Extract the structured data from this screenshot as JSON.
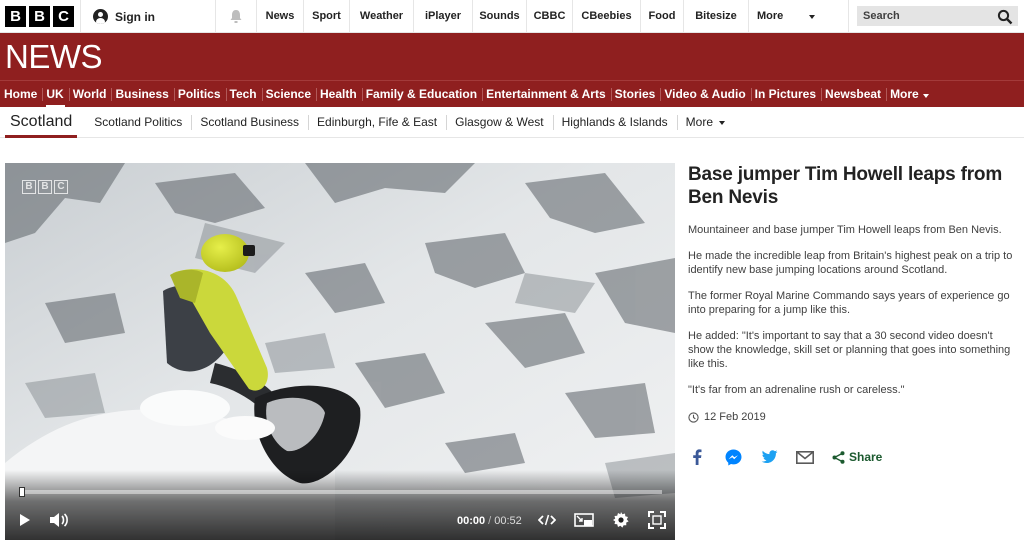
{
  "masthead": {
    "logo_letters": [
      "B",
      "B",
      "C"
    ],
    "signin_label": "Sign in",
    "nav": [
      {
        "label": "News",
        "name": "nav-news"
      },
      {
        "label": "Sport",
        "name": "nav-sport"
      },
      {
        "label": "Weather",
        "name": "nav-weather"
      },
      {
        "label": "iPlayer",
        "name": "nav-iplayer"
      },
      {
        "label": "Sounds",
        "name": "nav-sounds"
      },
      {
        "label": "CBBC",
        "name": "nav-cbbc"
      },
      {
        "label": "CBeebies",
        "name": "nav-cbeebies"
      },
      {
        "label": "Food",
        "name": "nav-food"
      },
      {
        "label": "Bitesize",
        "name": "nav-bitesize"
      },
      {
        "label": "More",
        "name": "nav-more"
      }
    ],
    "search_placeholder": "Search"
  },
  "banner": {
    "title": "NEWS",
    "color": "#8f1f1f"
  },
  "sections": [
    {
      "label": "Home",
      "active": false
    },
    {
      "label": "UK",
      "active": true
    },
    {
      "label": "World",
      "active": false
    },
    {
      "label": "Business",
      "active": false
    },
    {
      "label": "Politics",
      "active": false
    },
    {
      "label": "Tech",
      "active": false
    },
    {
      "label": "Science",
      "active": false
    },
    {
      "label": "Health",
      "active": false
    },
    {
      "label": "Family & Education",
      "active": false
    },
    {
      "label": "Entertainment & Arts",
      "active": false
    },
    {
      "label": "Stories",
      "active": false
    },
    {
      "label": "Video & Audio",
      "active": false
    },
    {
      "label": "In Pictures",
      "active": false
    },
    {
      "label": "Newsbeat",
      "active": false
    },
    {
      "label": "More",
      "active": false
    }
  ],
  "subnav": {
    "title": "Scotland",
    "items": [
      "Scotland Politics",
      "Scotland Business",
      "Edinburgh, Fife & East",
      "Glasgow & West",
      "Highlands & Islands"
    ],
    "more_label": "More"
  },
  "player": {
    "watermark": [
      "B",
      "B",
      "C"
    ],
    "current_time": "00:00",
    "separator": "/",
    "duration": "00:52",
    "progress_fraction": 0.0
  },
  "article": {
    "headline": "Base jumper Tim Howell leaps from Ben Nevis",
    "paragraphs": [
      "Mountaineer and base jumper Tim Howell leaps from Ben Nevis.",
      "He made the incredible leap from Britain's highest peak on a trip to identify new base jumping locations around Scotland.",
      "The former Royal Marine Commando says years of experience go into preparing for a jump like this.",
      "He added: \"It's important to say that a 30 second video doesn't show the knowledge, skill set or planning that goes into something like this.",
      "\"It's far from an adrenaline rush or careless.\""
    ],
    "date": "12 Feb 2019"
  },
  "share": {
    "icons": [
      "facebook-icon",
      "messenger-icon",
      "twitter-icon",
      "email-icon"
    ],
    "share_label": "Share",
    "share_color": "#1c5a2f"
  }
}
